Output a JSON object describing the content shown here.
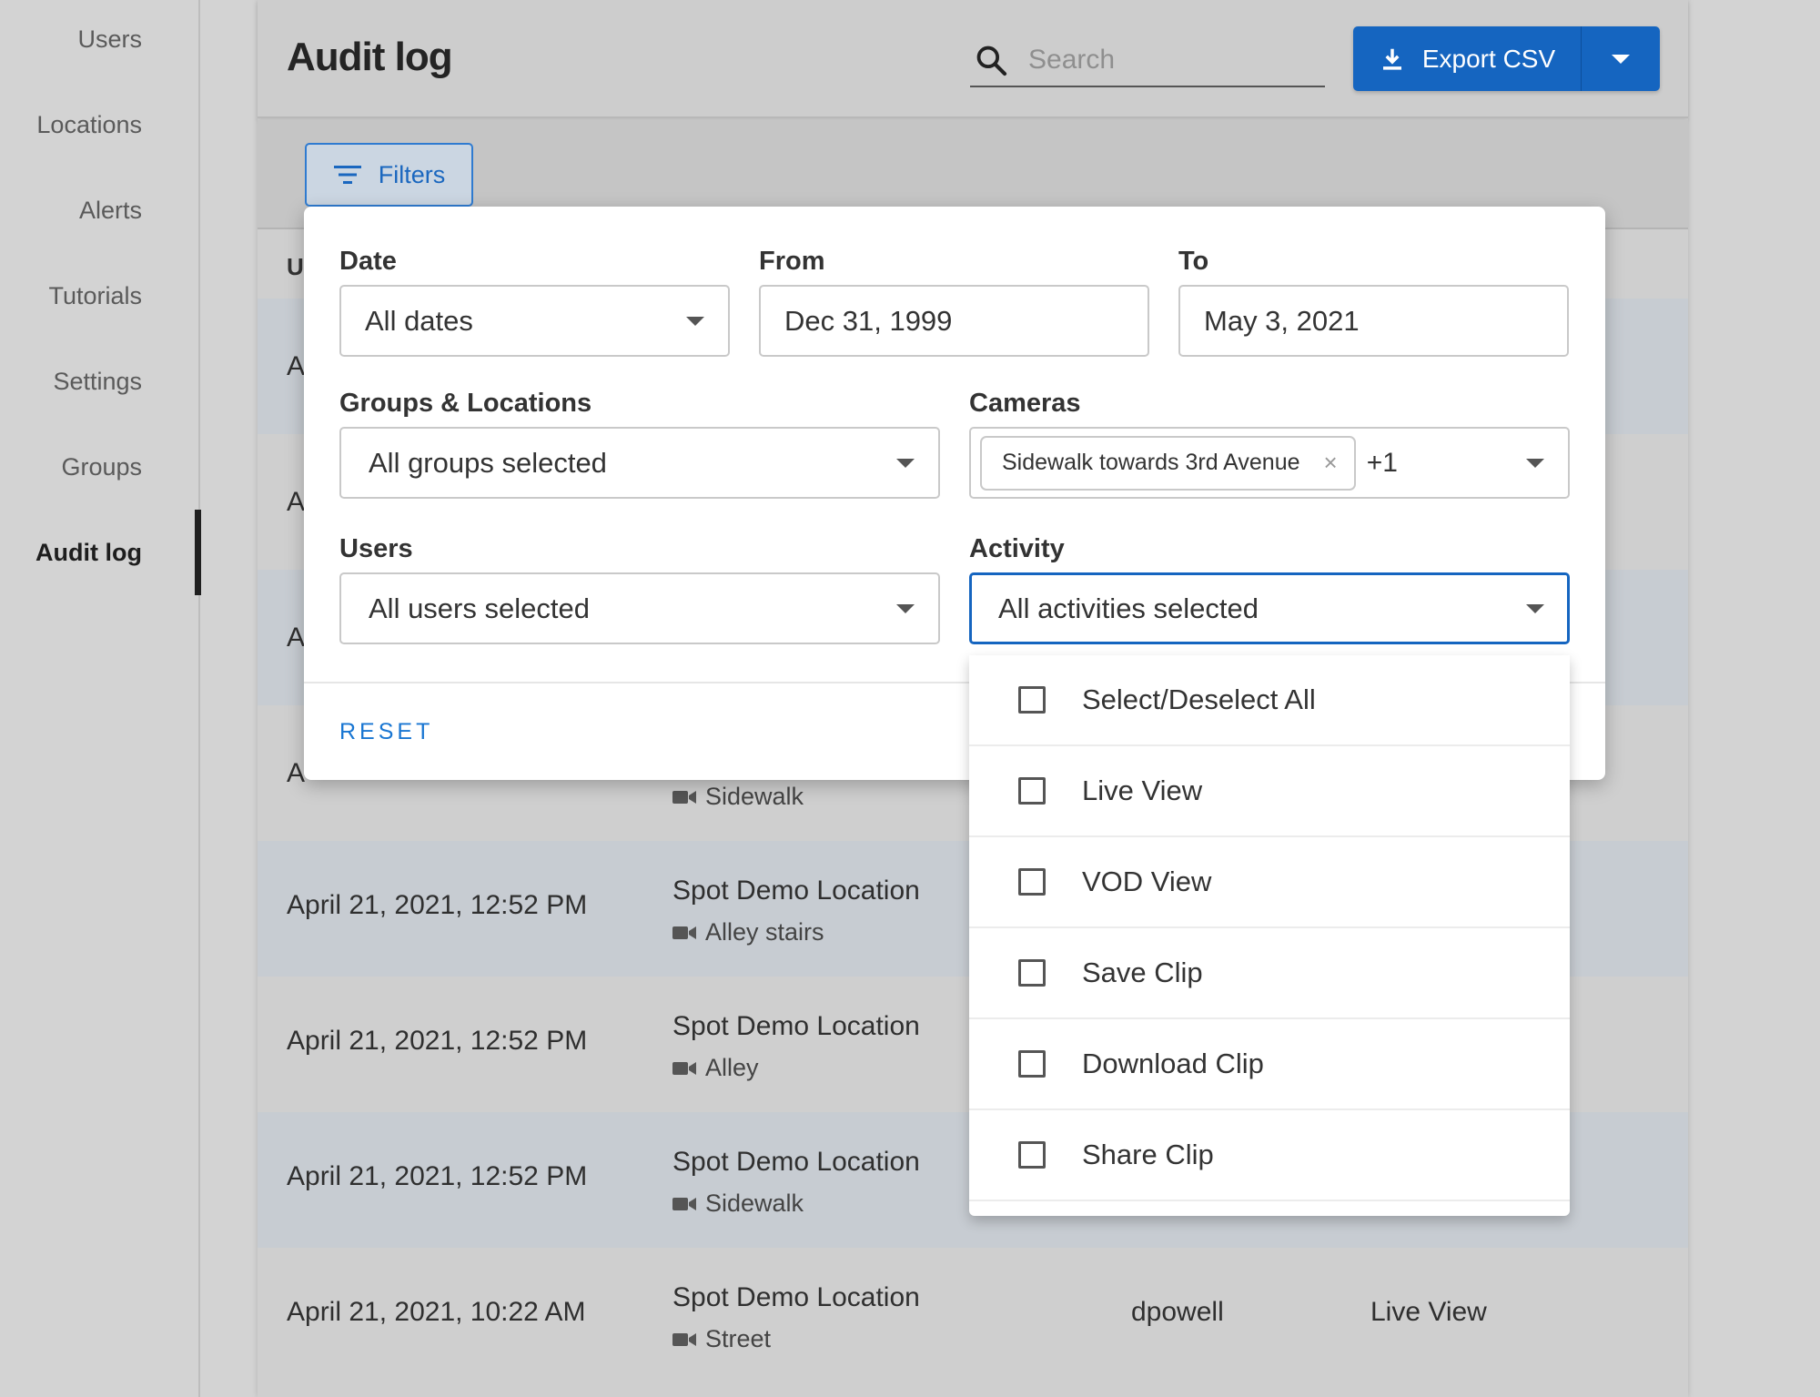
{
  "sidebar": {
    "items": [
      {
        "label": "Users"
      },
      {
        "label": "Locations"
      },
      {
        "label": "Alerts"
      },
      {
        "label": "Tutorials"
      },
      {
        "label": "Settings"
      },
      {
        "label": "Groups"
      },
      {
        "label": "Audit log",
        "active": true
      }
    ]
  },
  "header": {
    "title": "Audit log",
    "search_placeholder": "Search",
    "export_label": "Export CSV"
  },
  "toolbar": {
    "filters_label": "Filters"
  },
  "table": {
    "header_fragment": "U",
    "rows": [
      {
        "date": "A",
        "location": "",
        "camera": "",
        "user": "",
        "activity": ""
      },
      {
        "date": "A",
        "location": "",
        "camera": "",
        "user": "",
        "activity": ""
      },
      {
        "date": "A",
        "location": "",
        "camera": "",
        "user": "",
        "activity": ""
      },
      {
        "date": "A",
        "location": "",
        "camera": "Sidewalk",
        "user": "",
        "activity": ""
      },
      {
        "date": "April 21, 2021, 12:52 PM",
        "location": "Spot Demo Location",
        "camera": "Alley stairs",
        "user": "",
        "activity": ""
      },
      {
        "date": "April 21, 2021, 12:52 PM",
        "location": "Spot Demo Location",
        "camera": "Alley",
        "user": "",
        "activity": ""
      },
      {
        "date": "April 21, 2021, 12:52 PM",
        "location": "Spot Demo Location",
        "camera": "Sidewalk",
        "user": "",
        "activity": ""
      },
      {
        "date": "April 21, 2021, 10:22 AM",
        "location": "Spot Demo Location",
        "camera": "Street",
        "user": "dpowell",
        "activity": "Live View"
      }
    ]
  },
  "filters": {
    "date": {
      "label": "Date",
      "value": "All dates"
    },
    "from": {
      "label": "From",
      "value": "Dec 31, 1999"
    },
    "to": {
      "label": "To",
      "value": "May 3, 2021"
    },
    "groups": {
      "label": "Groups & Locations",
      "value": "All groups selected"
    },
    "cameras": {
      "label": "Cameras",
      "chip": "Sidewalk towards 3rd Avenue",
      "chip_remove": "×",
      "more": "+1"
    },
    "users": {
      "label": "Users",
      "value": "All users selected"
    },
    "activity": {
      "label": "Activity",
      "value": "All activities selected"
    },
    "reset_label": "RESET"
  },
  "activity_menu": {
    "options": [
      {
        "label": "Select/Deselect All",
        "checked": false
      },
      {
        "label": "Live View",
        "checked": false
      },
      {
        "label": "VOD View",
        "checked": false
      },
      {
        "label": "Save Clip",
        "checked": false
      },
      {
        "label": "Download Clip",
        "checked": false
      },
      {
        "label": "Share Clip",
        "checked": false
      }
    ]
  },
  "colors": {
    "accent": "#1565c0",
    "link": "#1976d2"
  }
}
